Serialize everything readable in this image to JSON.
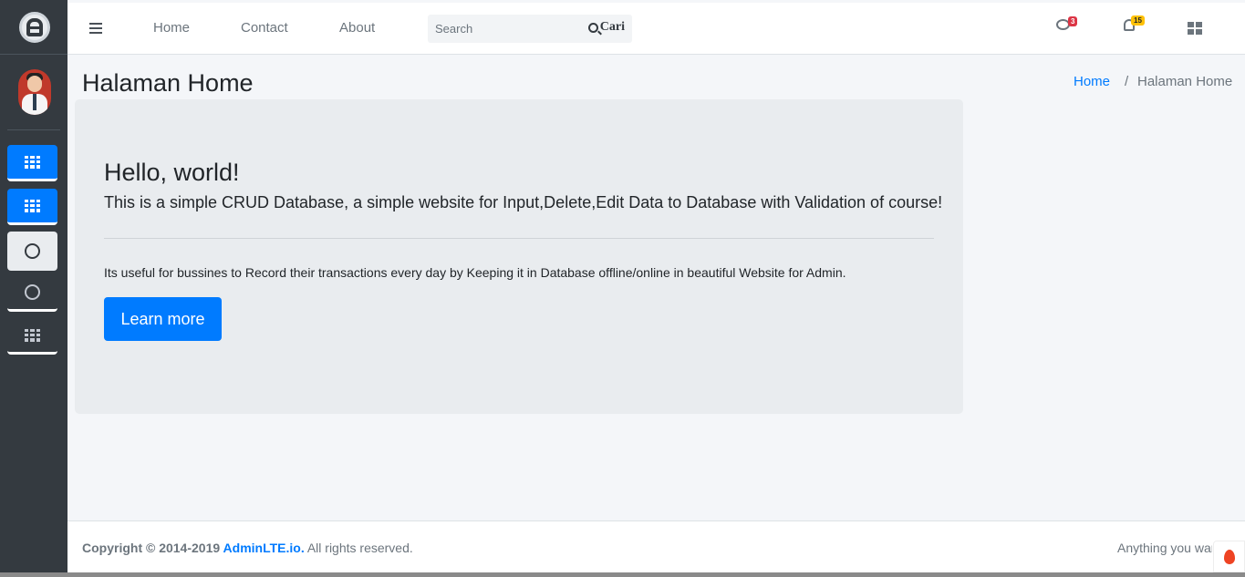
{
  "navbar": {
    "links": [
      "Home",
      "Contact",
      "About"
    ],
    "search_placeholder": "Search",
    "search_button": "Cari",
    "messages_count": "3",
    "notifications_count": "15"
  },
  "sidebar": {
    "items": [
      {
        "icon": "grid-icon",
        "state": "active"
      },
      {
        "icon": "grid-icon",
        "state": "active"
      },
      {
        "icon": "circle-icon",
        "state": "highlighted"
      },
      {
        "icon": "circle-icon",
        "state": "normal"
      },
      {
        "icon": "grid-icon",
        "state": "normal"
      }
    ]
  },
  "header": {
    "title": "Halaman Home",
    "breadcrumb": {
      "home": "Home",
      "separator": "/",
      "current": "Halaman Home"
    }
  },
  "jumbotron": {
    "title": "Hello, world!",
    "lead": "This is a simple CRUD Database, a simple website for Input,Delete,Edit Data to Database with Validation of course!",
    "text": "Its useful for bussines to Record their transactions every day by Keeping it in Database offline/online in beautiful Website for Admin.",
    "button": "Learn more"
  },
  "footer": {
    "copyright_prefix": "Copyright © 2014-2019 ",
    "brand": "AdminLTE.io.",
    "rights": " All rights reserved.",
    "right_text": "Anything you want"
  },
  "colors": {
    "primary": "#007bff",
    "sidebar": "#343a40",
    "danger": "#dc3545",
    "warning": "#ffc107"
  }
}
